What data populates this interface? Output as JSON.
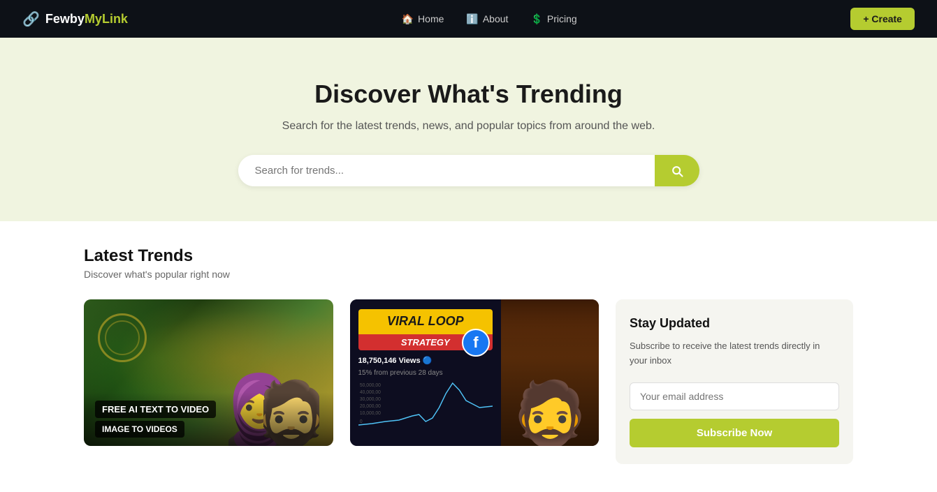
{
  "nav": {
    "logo_icon": "🔗",
    "logo_text_few": "Few",
    "logo_text_by": "by",
    "logo_text_mylink": "MyLink",
    "links": [
      {
        "id": "home",
        "label": "Home",
        "icon": "🏠"
      },
      {
        "id": "about",
        "label": "About",
        "icon": "ℹ️"
      },
      {
        "id": "pricing",
        "label": "Pricing",
        "icon": "💲"
      }
    ],
    "create_btn": "+ Create"
  },
  "hero": {
    "title": "Discover What's Trending",
    "subtitle": "Search for the latest trends, news, and popular topics from around the web.",
    "search_placeholder": "Search for trends...",
    "search_btn_aria": "Search"
  },
  "latest_trends": {
    "title": "Latest Trends",
    "subtitle": "Discover what's popular right now"
  },
  "card1": {
    "badge1": "FREE AI TEXT TO VIDEO",
    "badge2": "IMAGE TO VIDEOS"
  },
  "card2": {
    "title": "VIRAL LOOP",
    "strategy": "STRATEGY",
    "views": "18,750,146 Views 🔵",
    "stats": "15% from previous 28 days"
  },
  "sidebar": {
    "title": "Stay Updated",
    "description": "Subscribe to receive the latest trends directly in your inbox",
    "email_placeholder": "Your email address",
    "subscribe_btn": "Subscribe Now"
  }
}
